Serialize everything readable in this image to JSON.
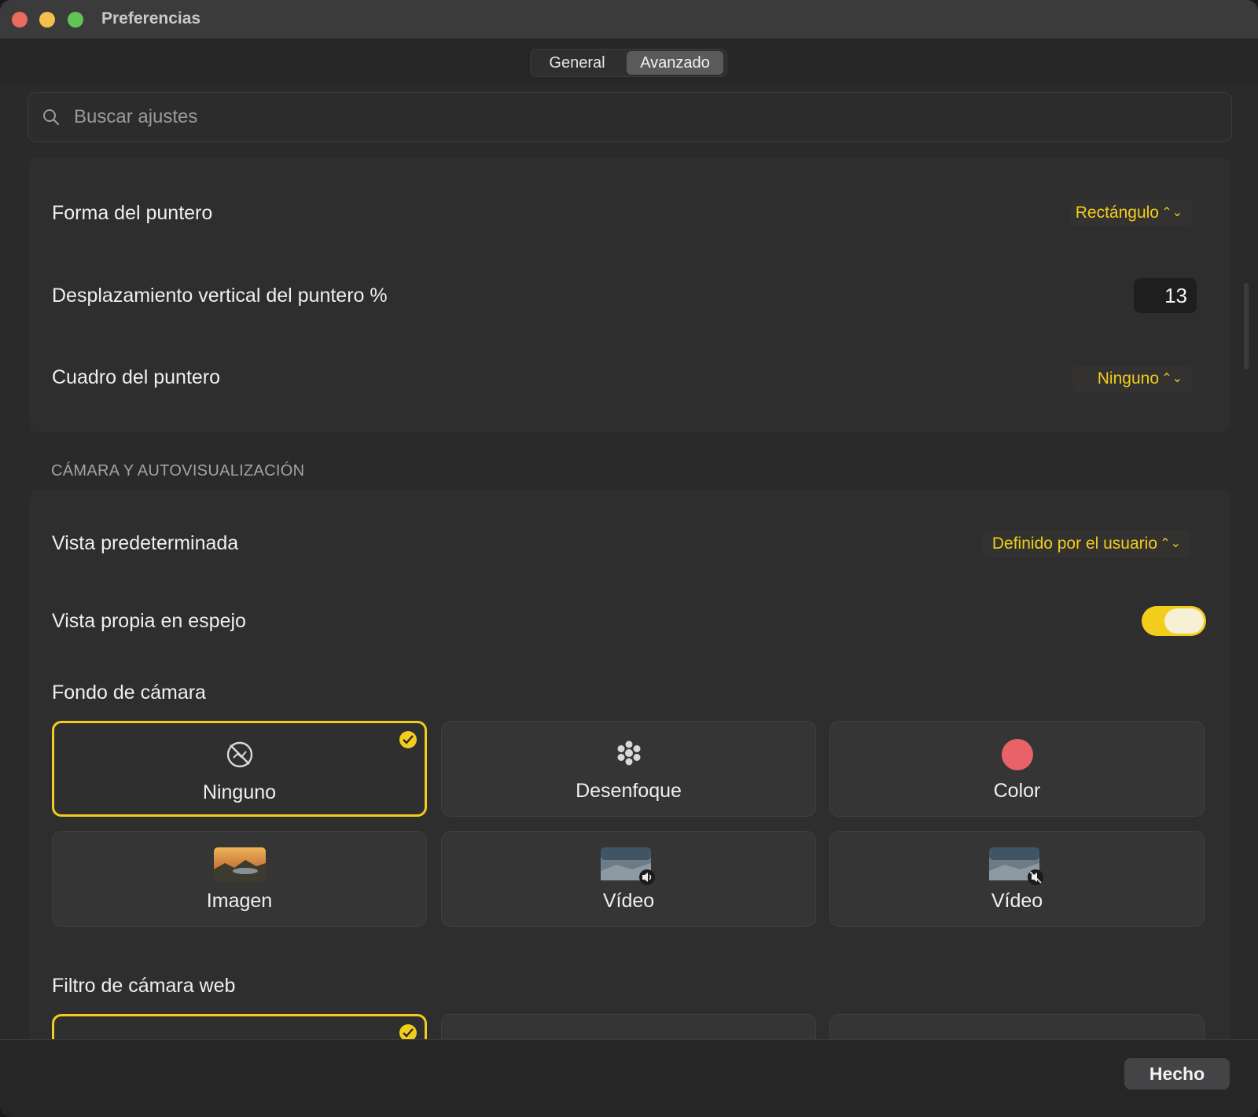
{
  "window": {
    "title": "Preferencias"
  },
  "tabs": [
    {
      "label": "General",
      "selected": false
    },
    {
      "label": "Avanzado",
      "selected": true
    }
  ],
  "search": {
    "placeholder": "Buscar ajustes",
    "value": ""
  },
  "pointer": {
    "shape_label": "Forma del puntero",
    "shape_value": "Rectángulo",
    "offset_label": "Desplazamiento vertical del puntero %",
    "offset_value": "13",
    "frame_label": "Cuadro del puntero",
    "frame_value": "Ninguno"
  },
  "camera": {
    "section_title": "CÁMARA Y AUTOVISUALIZACIÓN",
    "default_view_label": "Vista predeterminada",
    "default_view_value": "Definido por el usuario",
    "mirror_label": "Vista propia en espejo",
    "mirror_enabled": true,
    "background_label": "Fondo de cámara",
    "backgrounds": [
      {
        "label": "Ninguno",
        "icon": "no-background-icon",
        "selected": true
      },
      {
        "label": "Desenfoque",
        "icon": "blur-icon",
        "selected": false
      },
      {
        "label": "Color",
        "icon": "color-swatch-icon",
        "selected": false
      },
      {
        "label": "Imagen",
        "icon": "image-thumbnail-icon",
        "selected": false
      },
      {
        "label": "Vídeo",
        "icon": "video-with-sound-icon",
        "selected": false
      },
      {
        "label": "Vídeo",
        "icon": "video-muted-icon",
        "selected": false
      }
    ],
    "filter_label": "Filtro de cámara web"
  },
  "colors": {
    "accent": "#f2cd1c",
    "color_swatch": "#e86268"
  },
  "footer": {
    "done_label": "Hecho"
  }
}
